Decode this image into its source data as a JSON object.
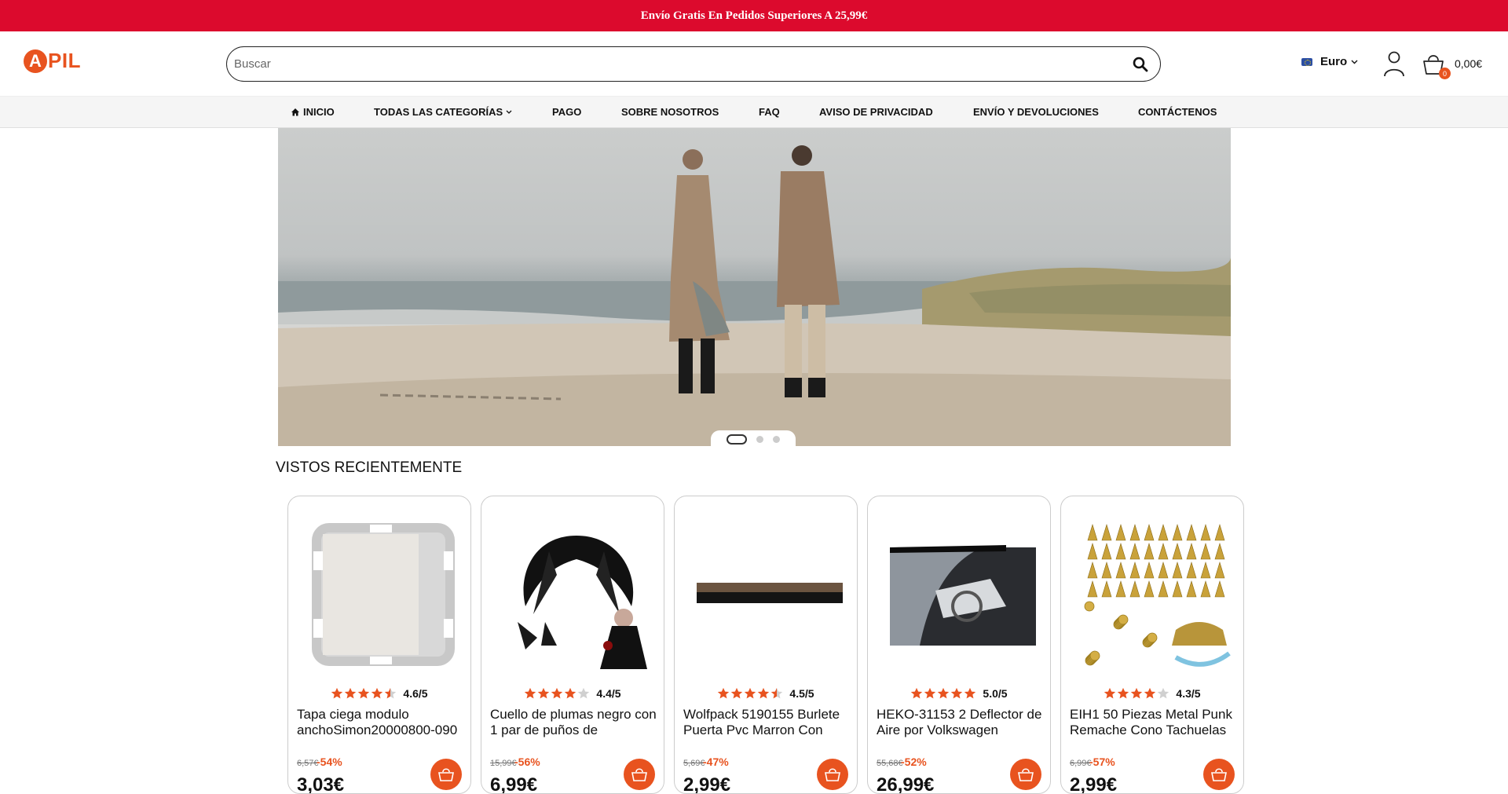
{
  "promo": {
    "text": "Envío Gratis En Pedidos Superiores A 25,99€"
  },
  "brand": {
    "logo_letter": "A",
    "logo_text": "PIL",
    "accent": "#e8531f"
  },
  "search": {
    "placeholder": "Buscar"
  },
  "currency": {
    "label": "Euro",
    "icon": "eu-flag-icon"
  },
  "cart": {
    "count": "0",
    "total": "0,00€"
  },
  "nav": {
    "items": [
      {
        "label": "INICIO",
        "icon": "home-icon"
      },
      {
        "label": "TODAS LAS CATEGORÍAS",
        "icon": "chevron-down-icon"
      },
      {
        "label": "PAGO"
      },
      {
        "label": "SOBRE NOSOTROS"
      },
      {
        "label": "FAQ"
      },
      {
        "label": "AVISO DE PRIVACIDAD"
      },
      {
        "label": "ENVÍO Y DEVOLUCIONES"
      },
      {
        "label": "CONTÁCTENOS"
      }
    ]
  },
  "hero": {
    "slide_count": 3,
    "active_slide": 1
  },
  "recent": {
    "title": "VISTOS RECIENTEMENTE",
    "products": [
      {
        "rating": "4.6/5",
        "stars": 4.5,
        "title": "Tapa ciega modulo anchoSimon20000800-090",
        "old_price": "6,57€",
        "discount": "-54%",
        "price": "3,03€"
      },
      {
        "rating": "4.4/5",
        "stars": 4.0,
        "title": "Cuello de plumas negro con 1 par de puños de",
        "old_price": "15,99€",
        "discount": "-56%",
        "price": "6,99€"
      },
      {
        "rating": "4.5/5",
        "stars": 4.5,
        "title": "Wolfpack 5190155 Burlete Puerta Pvc Marron Con",
        "old_price": "5,69€",
        "discount": "-47%",
        "price": "2,99€"
      },
      {
        "rating": "5.0/5",
        "stars": 5.0,
        "title": "HEKO-31153 2 Deflector de Aire por Volkswagen",
        "old_price": "55,68€",
        "discount": "-52%",
        "price": "26,99€"
      },
      {
        "rating": "4.3/5",
        "stars": 4.0,
        "title": "EIH1 50 Piezas Metal Punk Remache Cono Tachuelas",
        "old_price": "6,99€",
        "discount": "-57%",
        "price": "2,99€"
      }
    ]
  }
}
